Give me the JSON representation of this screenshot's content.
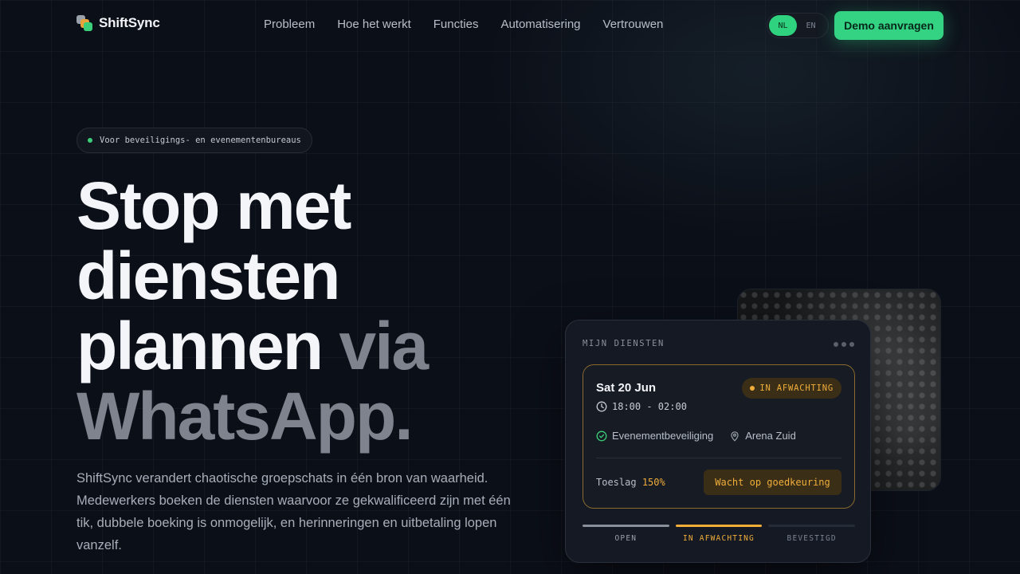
{
  "nav": {
    "brand": "ShiftSync",
    "links": [
      "Probleem",
      "Hoe het werkt",
      "Functies",
      "Automatisering",
      "Vertrouwen"
    ],
    "lang": {
      "active": "NL",
      "other": "EN"
    },
    "cta": "Demo aanvragen"
  },
  "hero": {
    "badge": "Voor beveiligings- en evenementenbureaus",
    "headline_main": "Stop met diensten plannen",
    "headline_muted": "via WhatsApp.",
    "subtext": "ShiftSync verandert chaotische groepschats in één bron van waarheid. Medewerkers boeken de diensten waarvoor ze gekwalificeerd zijn met één tik, dubbele boeking is onmogelijk, en herinneringen en uitbetaling lopen vanzelf."
  },
  "card": {
    "title": "MIJN DIENSTEN",
    "shift": {
      "date": "Sat 20 Jun",
      "status": "IN AFWACHTING",
      "time": "18:00 - 02:00",
      "role": "Evenementbeveiliging",
      "location": "Arena Zuid",
      "toeslag_label": "Toeslag",
      "toeslag_value": "150%",
      "action": "Wacht op goedkeuring"
    },
    "steps": [
      "OPEN",
      "IN AFWACHTING",
      "BEVESTIGD"
    ]
  },
  "colors": {
    "accent_green": "#34d383",
    "pending_amber": "#f0ad3a",
    "background": "#0b0f18"
  }
}
